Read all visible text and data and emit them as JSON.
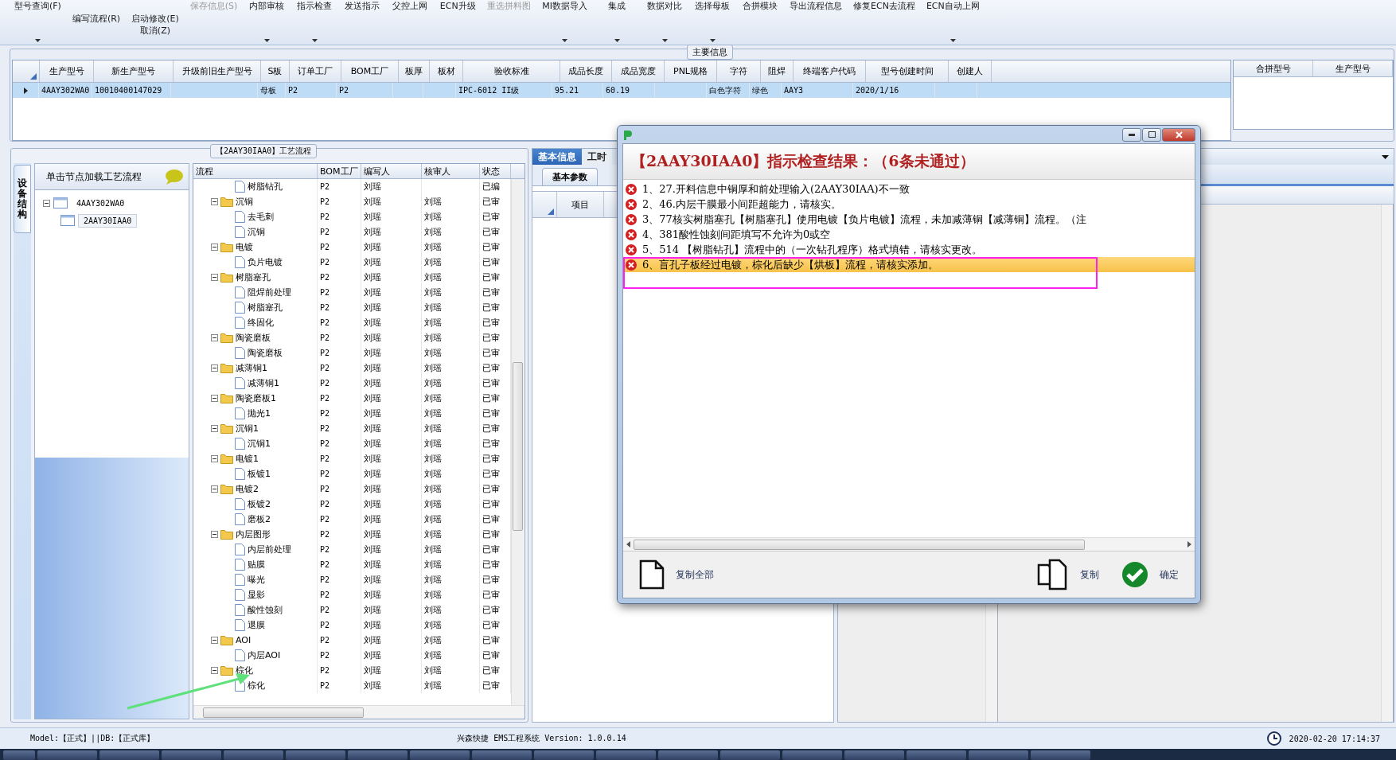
{
  "toolbar": [
    {
      "items": [
        {
          "label": "型号查询(F)",
          "kind": "top",
          "disabled": false,
          "dropdown": true
        }
      ]
    },
    {
      "items": [
        {
          "label": "编写流程(R)",
          "kind": "middle",
          "disabled": false,
          "dropdown": false
        }
      ]
    },
    {
      "items": [
        {
          "label": "启动修改(E)",
          "kind": "middle",
          "disabled": false,
          "dropdown": false
        },
        {
          "label": "取消(Z)",
          "kind": "bottom",
          "disabled": false,
          "dropdown": false
        }
      ]
    },
    {
      "items": [
        {
          "label": "保存信息(S)",
          "kind": "top",
          "disabled": true,
          "dropdown": false
        }
      ]
    },
    {
      "items": [
        {
          "label": "内部审核",
          "kind": "top",
          "disabled": false,
          "dropdown": true
        }
      ]
    },
    {
      "items": [
        {
          "label": "指示检查",
          "kind": "top",
          "disabled": false,
          "dropdown": true
        }
      ]
    },
    {
      "items": [
        {
          "label": "发送指示",
          "kind": "top",
          "disabled": false,
          "dropdown": false
        }
      ]
    },
    {
      "items": [
        {
          "label": "父控上网",
          "kind": "top",
          "disabled": false,
          "dropdown": false
        }
      ]
    },
    {
      "items": [
        {
          "label": "ECN升级",
          "kind": "top",
          "disabled": false,
          "dropdown": false
        }
      ]
    },
    {
      "items": [
        {
          "label": "重选拼料图",
          "kind": "top",
          "disabled": true,
          "dropdown": false
        }
      ]
    },
    {
      "items": [
        {
          "label": "MI数据导入",
          "kind": "top",
          "disabled": false,
          "dropdown": true
        }
      ]
    },
    {
      "items": [
        {
          "label": "集成",
          "kind": "top",
          "disabled": false,
          "dropdown": true
        }
      ]
    },
    {
      "items": [
        {
          "label": "数据对比",
          "kind": "top",
          "disabled": false,
          "dropdown": true
        }
      ]
    },
    {
      "items": [
        {
          "label": "选择母板",
          "kind": "top",
          "disabled": false,
          "dropdown": true
        }
      ]
    },
    {
      "items": [
        {
          "label": "合拼模块",
          "kind": "top",
          "disabled": false,
          "dropdown": false
        }
      ]
    },
    {
      "items": [
        {
          "label": "导出流程信息",
          "kind": "top",
          "disabled": false,
          "dropdown": false
        }
      ]
    },
    {
      "items": [
        {
          "label": "修复ECN去流程",
          "kind": "top",
          "disabled": false,
          "dropdown": false
        }
      ]
    },
    {
      "items": [
        {
          "label": "ECN自动上网",
          "kind": "top",
          "disabled": false,
          "dropdown": true
        }
      ]
    }
  ],
  "main_info": {
    "title": "主要信息",
    "columns": [
      "生产型号",
      "新生产型号",
      "升级前旧生产型号",
      "S板",
      "订单工厂",
      "BOM工厂",
      "板厚",
      "板材",
      "验收标准",
      "成品长度",
      "成品宽度",
      "PNL规格",
      "字符",
      "阻焊",
      "终端客户代码",
      "型号创建时间",
      "创建人"
    ],
    "rows": [
      {
        "selected": true,
        "cells": [
          "4AAY302WA0",
          "10010400147029",
          "",
          "母板",
          "P2",
          "P2",
          "",
          "",
          "IPC-6012 II级",
          "95.21",
          "60.19",
          "",
          "白色字符",
          "绿色",
          "AAY3",
          "2020/1/16",
          ""
        ]
      }
    ],
    "side_columns": [
      "合拼型号",
      "生产型号"
    ]
  },
  "process": {
    "title": "【2AAY30IAA0】工艺流程",
    "side_tab": "设备结构",
    "tree_header": "单击节点加载工艺流程",
    "tree": [
      {
        "label": "4AAY302WA0",
        "selected": false,
        "expanded": true,
        "children": [
          {
            "label": "2AAY30IAA0",
            "selected": true
          }
        ]
      }
    ],
    "columns": [
      "流程",
      "BOM工厂",
      "编写人",
      "核审人",
      "状态"
    ],
    "rows": [
      {
        "kind": "step",
        "name": "树脂钻孔",
        "bom": "P2",
        "writer": "刘瑶",
        "reviewer": "",
        "status": "已编"
      },
      {
        "kind": "folder",
        "name": "沉铜",
        "bom": "P2",
        "writer": "刘瑶",
        "reviewer": "刘瑶",
        "status": "已审",
        "expanded": true,
        "children": [
          {
            "kind": "step",
            "name": "去毛刺",
            "bom": "P2",
            "writer": "刘瑶",
            "reviewer": "刘瑶",
            "status": "已审"
          },
          {
            "kind": "step",
            "name": "沉铜",
            "bom": "P2",
            "writer": "刘瑶",
            "reviewer": "刘瑶",
            "status": "已审"
          }
        ]
      },
      {
        "kind": "folder",
        "name": "电镀",
        "bom": "P2",
        "writer": "刘瑶",
        "reviewer": "刘瑶",
        "status": "已审",
        "expanded": true,
        "children": [
          {
            "kind": "step",
            "name": "负片电镀",
            "bom": "P2",
            "writer": "刘瑶",
            "reviewer": "刘瑶",
            "status": "已审"
          }
        ]
      },
      {
        "kind": "folder",
        "name": "树脂塞孔",
        "bom": "P2",
        "writer": "刘瑶",
        "reviewer": "刘瑶",
        "status": "已审",
        "expanded": true,
        "children": [
          {
            "kind": "step",
            "name": "阻焊前处理",
            "bom": "P2",
            "writer": "刘瑶",
            "reviewer": "刘瑶",
            "status": "已审"
          },
          {
            "kind": "step",
            "name": "树脂塞孔",
            "bom": "P2",
            "writer": "刘瑶",
            "reviewer": "刘瑶",
            "status": "已审"
          },
          {
            "kind": "step",
            "name": "终固化",
            "bom": "P2",
            "writer": "刘瑶",
            "reviewer": "刘瑶",
            "status": "已审"
          }
        ]
      },
      {
        "kind": "folder",
        "name": "陶瓷磨板",
        "bom": "P2",
        "writer": "刘瑶",
        "reviewer": "刘瑶",
        "status": "已审",
        "expanded": true,
        "children": [
          {
            "kind": "step",
            "name": "陶瓷磨板",
            "bom": "P2",
            "writer": "刘瑶",
            "reviewer": "刘瑶",
            "status": "已审"
          }
        ]
      },
      {
        "kind": "folder",
        "name": "减薄铜1",
        "bom": "P2",
        "writer": "刘瑶",
        "reviewer": "刘瑶",
        "status": "已审",
        "expanded": true,
        "children": [
          {
            "kind": "step",
            "name": "减薄铜1",
            "bom": "P2",
            "writer": "刘瑶",
            "reviewer": "刘瑶",
            "status": "已审"
          }
        ]
      },
      {
        "kind": "folder",
        "name": "陶瓷磨板1",
        "bom": "P2",
        "writer": "刘瑶",
        "reviewer": "刘瑶",
        "status": "已审",
        "expanded": true,
        "children": [
          {
            "kind": "step",
            "name": "抛光1",
            "bom": "P2",
            "writer": "刘瑶",
            "reviewer": "刘瑶",
            "status": "已审"
          }
        ]
      },
      {
        "kind": "folder",
        "name": "沉铜1",
        "bom": "P2",
        "writer": "刘瑶",
        "reviewer": "刘瑶",
        "status": "已审",
        "expanded": true,
        "children": [
          {
            "kind": "step",
            "name": "沉铜1",
            "bom": "P2",
            "writer": "刘瑶",
            "reviewer": "刘瑶",
            "status": "已审"
          }
        ]
      },
      {
        "kind": "folder",
        "name": "电镀1",
        "bom": "P2",
        "writer": "刘瑶",
        "reviewer": "刘瑶",
        "status": "已审",
        "expanded": true,
        "children": [
          {
            "kind": "step",
            "name": "板镀1",
            "bom": "P2",
            "writer": "刘瑶",
            "reviewer": "刘瑶",
            "status": "已审"
          }
        ]
      },
      {
        "kind": "folder",
        "name": "电镀2",
        "bom": "P2",
        "writer": "刘瑶",
        "reviewer": "刘瑶",
        "status": "已审",
        "expanded": true,
        "children": [
          {
            "kind": "step",
            "name": "板镀2",
            "bom": "P2",
            "writer": "刘瑶",
            "reviewer": "刘瑶",
            "status": "已审"
          },
          {
            "kind": "step",
            "name": "磨板2",
            "bom": "P2",
            "writer": "刘瑶",
            "reviewer": "刘瑶",
            "status": "已审"
          }
        ]
      },
      {
        "kind": "folder",
        "name": "内层图形",
        "bom": "P2",
        "writer": "刘瑶",
        "reviewer": "刘瑶",
        "status": "已审",
        "expanded": true,
        "children": [
          {
            "kind": "step",
            "name": "内层前处理",
            "bom": "P2",
            "writer": "刘瑶",
            "reviewer": "刘瑶",
            "status": "已审"
          },
          {
            "kind": "step",
            "name": "贴膜",
            "bom": "P2",
            "writer": "刘瑶",
            "reviewer": "刘瑶",
            "status": "已审"
          },
          {
            "kind": "step",
            "name": "曝光",
            "bom": "P2",
            "writer": "刘瑶",
            "reviewer": "刘瑶",
            "status": "已审"
          },
          {
            "kind": "step",
            "name": "显影",
            "bom": "P2",
            "writer": "刘瑶",
            "reviewer": "刘瑶",
            "status": "已审"
          },
          {
            "kind": "step",
            "name": "酸性蚀刻",
            "bom": "P2",
            "writer": "刘瑶",
            "reviewer": "刘瑶",
            "status": "已审"
          },
          {
            "kind": "step",
            "name": "退膜",
            "bom": "P2",
            "writer": "刘瑶",
            "reviewer": "刘瑶",
            "status": "已审"
          }
        ]
      },
      {
        "kind": "folder",
        "name": "AOI",
        "bom": "P2",
        "writer": "刘瑶",
        "reviewer": "刘瑶",
        "status": "已审",
        "expanded": true,
        "children": [
          {
            "kind": "step",
            "name": "内层AOI",
            "bom": "P2",
            "writer": "刘瑶",
            "reviewer": "刘瑶",
            "status": "已审"
          }
        ]
      },
      {
        "kind": "folder",
        "name": "棕化",
        "bom": "P2",
        "writer": "刘瑶",
        "reviewer": "刘瑶",
        "status": "已审",
        "expanded": true,
        "children": [
          {
            "kind": "step",
            "name": "棕化",
            "bom": "P2",
            "writer": "刘瑶",
            "reviewer": "刘瑶",
            "status": "已审"
          }
        ]
      }
    ]
  },
  "detail": {
    "tabs": [
      {
        "label": "基本信息",
        "selected": true
      },
      {
        "label": "工时",
        "selected": false
      }
    ],
    "subtabs": [
      {
        "label": "基本参数",
        "selected": true
      }
    ],
    "columns": [
      "项目"
    ]
  },
  "dialog": {
    "heading": "【2AAY30IAA0】指示检查结果：（6条未通过）",
    "items": [
      {
        "text": "1、27.开料信息中铜厚和前处理输入(2AAY30IAA)不一致",
        "selected": false
      },
      {
        "text": "2、46.内层干膜最小间距超能力，请核实。",
        "selected": false
      },
      {
        "text": "3、77核实树脂塞孔【树脂塞孔】使用电镀【负片电镀】流程，未加减薄铜【减薄铜】流程。（注",
        "selected": false
      },
      {
        "text": "4、381酸性蚀刻间距填写不允许为0或空",
        "selected": false
      },
      {
        "text": "5、514 【树脂钻孔】流程中的（一次钻孔程序）格式填错，请核实更改。",
        "selected": false
      },
      {
        "text": "6、盲孔子板经过电镀，棕化后缺少【烘板】流程，请核实添加。",
        "selected": true
      }
    ],
    "buttons": [
      {
        "kind": "copy_all",
        "label": "复制全部"
      },
      {
        "kind": "copy",
        "label": "复制"
      },
      {
        "kind": "ok",
        "label": "确定"
      }
    ]
  },
  "status_bar": {
    "model": "Model:【正式】||DB:【正式库】",
    "app": "兴森快捷 EMS工程系统 Version: 1.0.0.14",
    "time": "2020-02-20 17:14:37"
  }
}
